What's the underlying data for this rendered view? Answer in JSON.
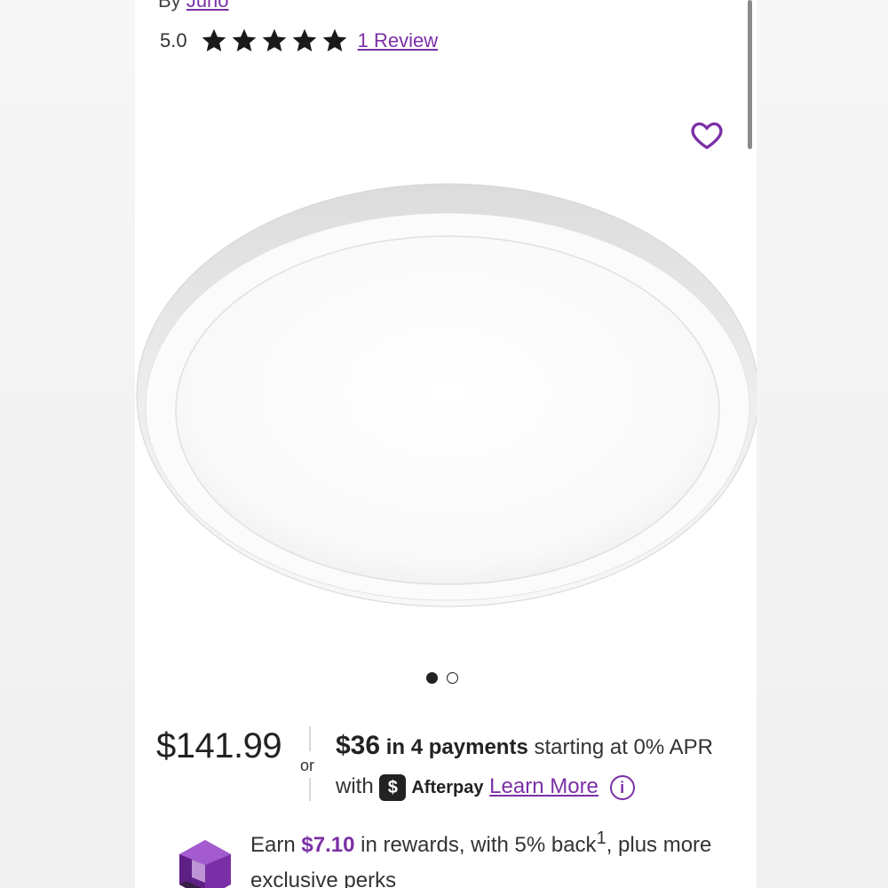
{
  "product": {
    "by_prefix": "By",
    "brand": "Juno",
    "rating_value": "5.0",
    "stars": 5,
    "review_link": "1 Review"
  },
  "gallery": {
    "total_images": 2,
    "active_index": 0
  },
  "pricing": {
    "price": "$141.99",
    "or": "or",
    "installment_amount": "$36",
    "installment_text": "in 4 payments",
    "installment_rest": "starting at 0%",
    "apr_text": "APR with",
    "afterpay_badge": "$",
    "afterpay_label": "Afterpay",
    "learn_more": "Learn More",
    "info_glyph": "i"
  },
  "rewards": {
    "prefix": "Earn",
    "amount": "$7.10",
    "middle": "in rewards, with 5% back",
    "superscript": "1",
    "suffix": ", plus more exclusive perks"
  },
  "colors": {
    "accent": "#7b2fa6",
    "text": "#222222",
    "background": "#ffffff"
  },
  "icons": {
    "favorite": "heart-outline-icon",
    "star": "star-filled-icon",
    "info": "info-circle-icon",
    "rewards": "purple-gem-icon"
  }
}
